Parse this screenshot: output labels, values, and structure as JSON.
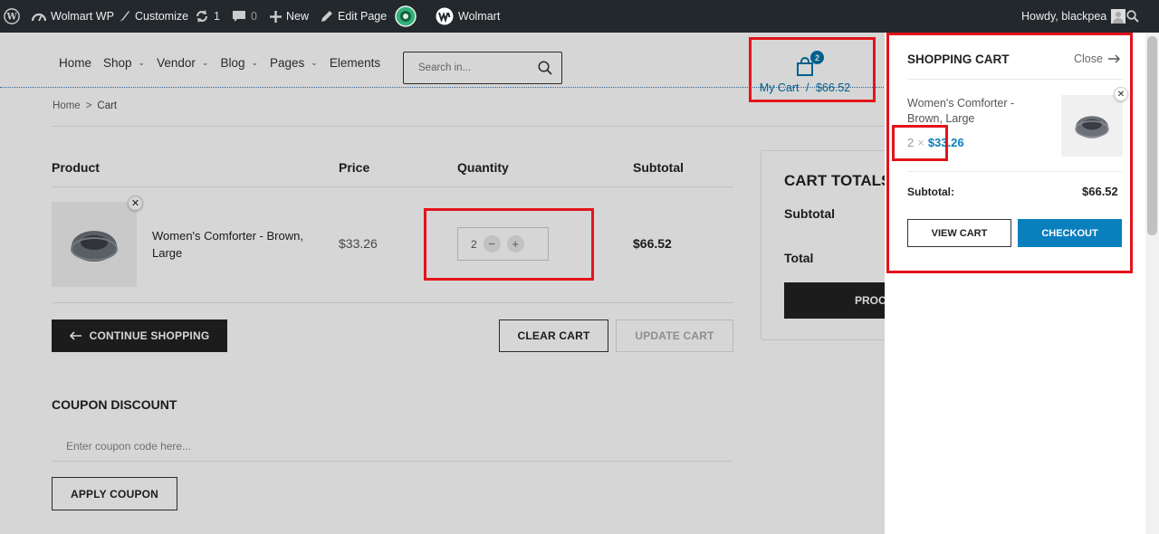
{
  "adminbar": {
    "site_name": "Wolmart WP",
    "customize": "Customize",
    "updates_count": "1",
    "comments_count": "0",
    "new_label": "New",
    "edit_page": "Edit Page",
    "wolmart": "Wolmart",
    "howdy": "Howdy, blackpea"
  },
  "nav": {
    "items": [
      "Home",
      "Shop",
      "Vendor",
      "Blog",
      "Pages",
      "Elements"
    ]
  },
  "search": {
    "placeholder": "Search in..."
  },
  "cart_widget": {
    "count": "2",
    "label": "My Cart",
    "separator": "/",
    "amount": "$66.52"
  },
  "breadcrumb": {
    "home": "Home",
    "sep": ">",
    "current": "Cart"
  },
  "table": {
    "headers": {
      "product": "Product",
      "price": "Price",
      "quantity": "Quantity",
      "subtotal": "Subtotal"
    },
    "row": {
      "name": "Women's Comforter - Brown, Large",
      "price": "$33.26",
      "quantity": "2",
      "subtotal": "$66.52"
    }
  },
  "buttons": {
    "continue": "Continue Shopping",
    "clear": "Clear Cart",
    "update": "Update Cart",
    "apply_coupon": "Apply Coupon"
  },
  "coupon": {
    "title": "COUPON DISCOUNT",
    "placeholder": "Enter coupon code here..."
  },
  "totals": {
    "title": "CART TOTALS",
    "subtotal": "Subtotal",
    "total": "Total",
    "proceed": "PROC"
  },
  "mini_cart": {
    "title": "SHOPPING CART",
    "close": "Close",
    "item_name": "Women's Comforter - Brown, Large",
    "qty": "2",
    "times": "×",
    "price": "$33.26",
    "subtotal_label": "Subtotal:",
    "subtotal_value": "$66.52",
    "view_cart": "VIEW CART",
    "checkout": "CHECKOUT"
  },
  "colors": {
    "accent": "#0a7fbd",
    "highlight": "#e3141b",
    "dark": "#222222"
  }
}
